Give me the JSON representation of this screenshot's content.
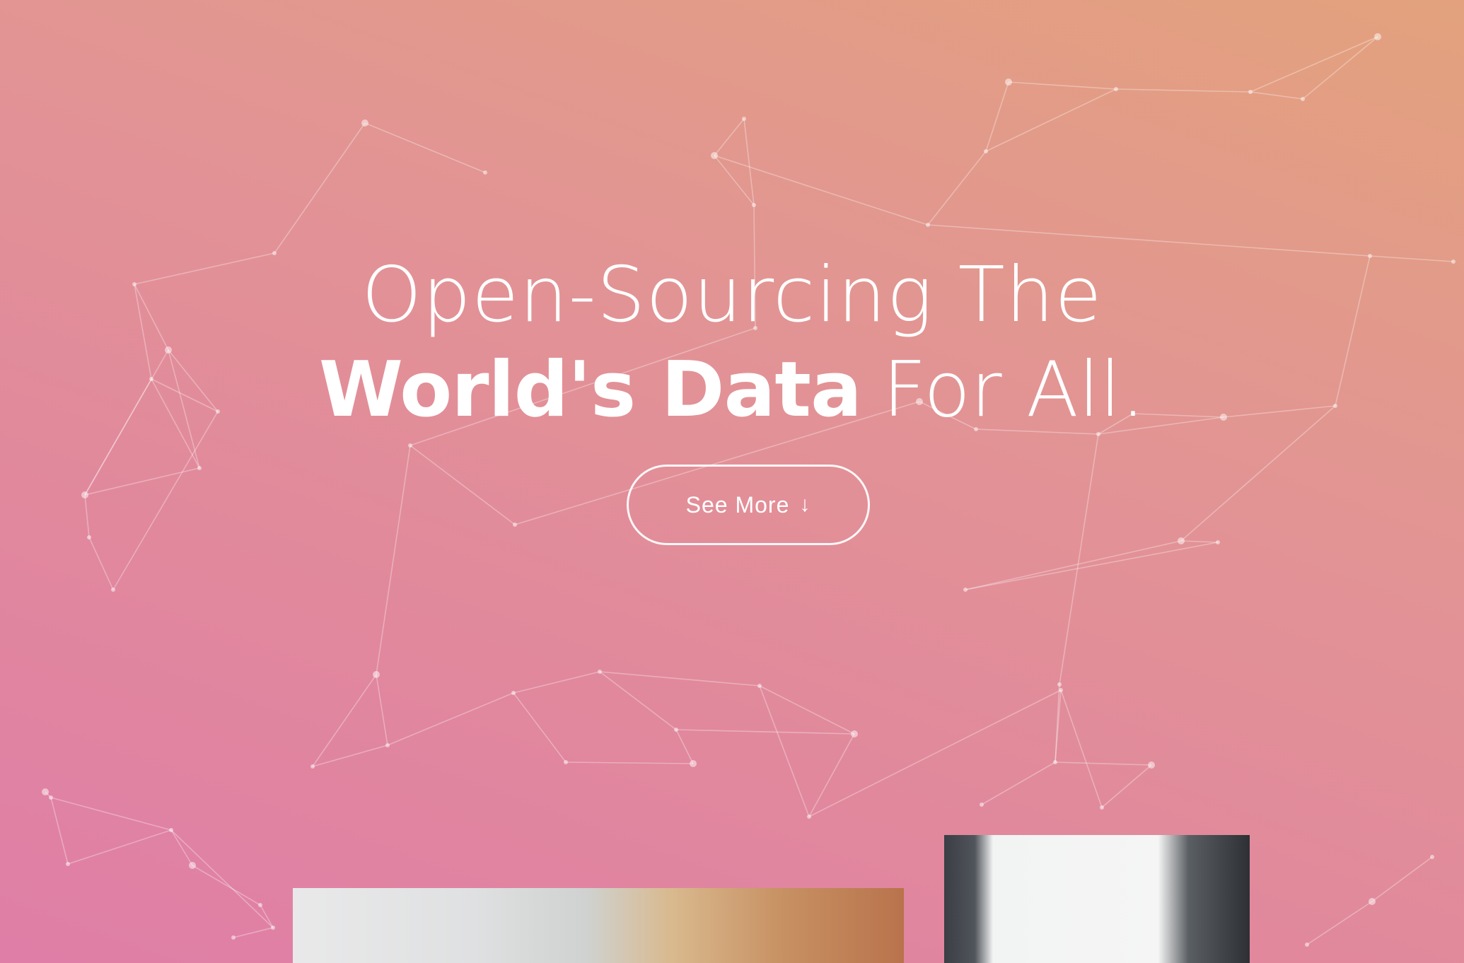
{
  "hero": {
    "headline_line1": "Open-Sourcing The",
    "headline_bold": "World's Data",
    "headline_rest": "For All.",
    "cta_label": "See More",
    "cta_icon": "arrow-down-icon",
    "cta_arrow": "↓"
  },
  "colors": {
    "gradient_start": "#e3a27d",
    "gradient_end": "#df7ea7",
    "text": "#ffffff"
  }
}
